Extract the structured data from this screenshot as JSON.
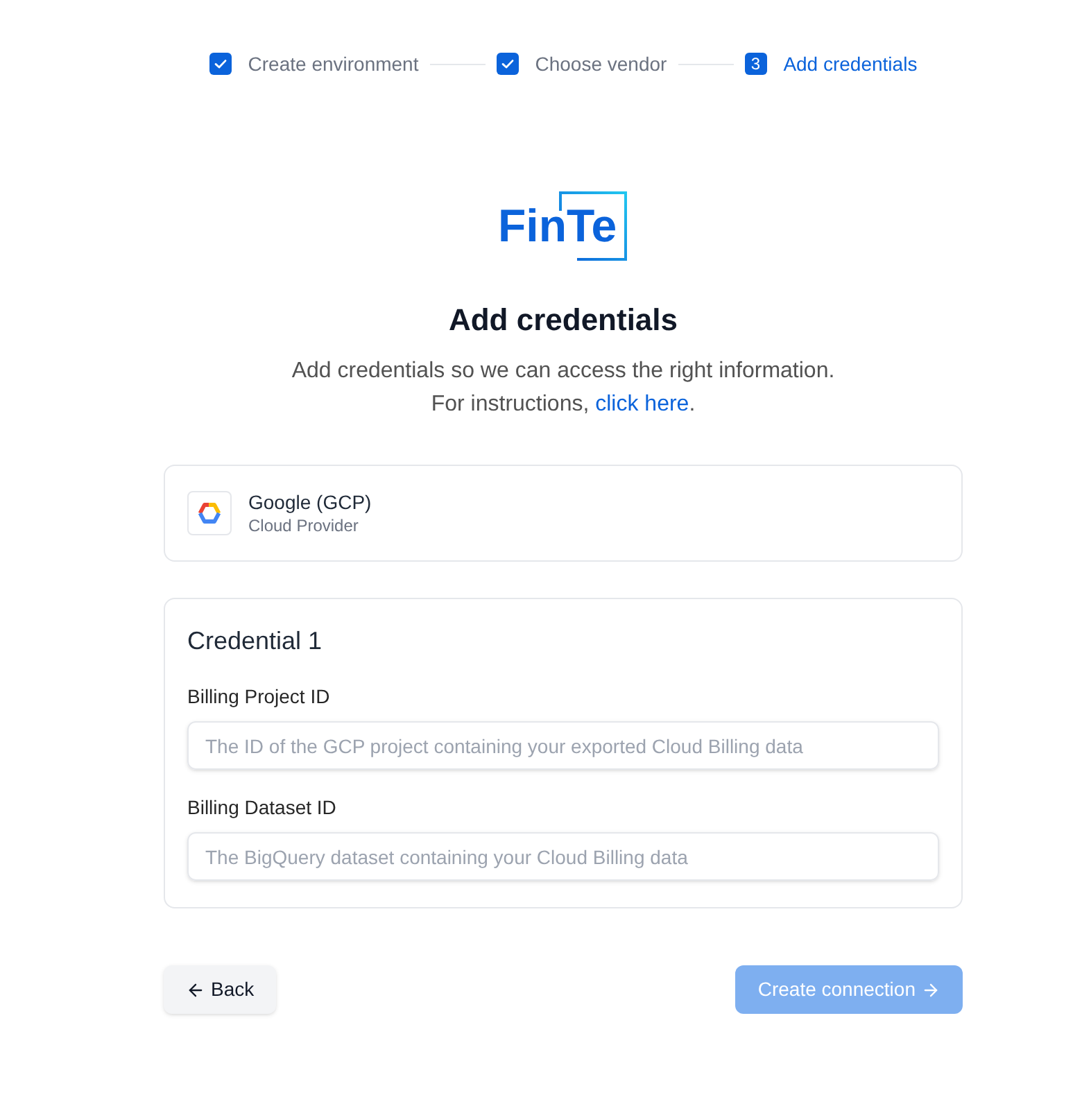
{
  "steps": [
    {
      "label": "Create environment",
      "completed": true,
      "current": false
    },
    {
      "label": "Choose vendor",
      "completed": true,
      "current": false
    },
    {
      "label": "Add credentials",
      "number": "3",
      "completed": false,
      "current": true
    }
  ],
  "logo": {
    "text": "FinTe"
  },
  "header": {
    "title": "Add credentials",
    "subtitle": "Add credentials so we can access the right information.",
    "instructions_prefix": "For instructions,",
    "instructions_link": "click here",
    "instructions_suffix": "."
  },
  "provider": {
    "name": "Google (GCP)",
    "type": "Cloud Provider"
  },
  "credential": {
    "title": "Credential 1",
    "fields": [
      {
        "label": "Billing Project ID",
        "placeholder": "The ID of the GCP project containing your exported Cloud Billing data"
      },
      {
        "label": "Billing Dataset ID",
        "placeholder": "The BigQuery dataset containing your Cloud Billing data"
      }
    ]
  },
  "actions": {
    "back": {
      "label": "Back"
    },
    "submit": {
      "label": "Create connection",
      "disabled": true
    }
  }
}
